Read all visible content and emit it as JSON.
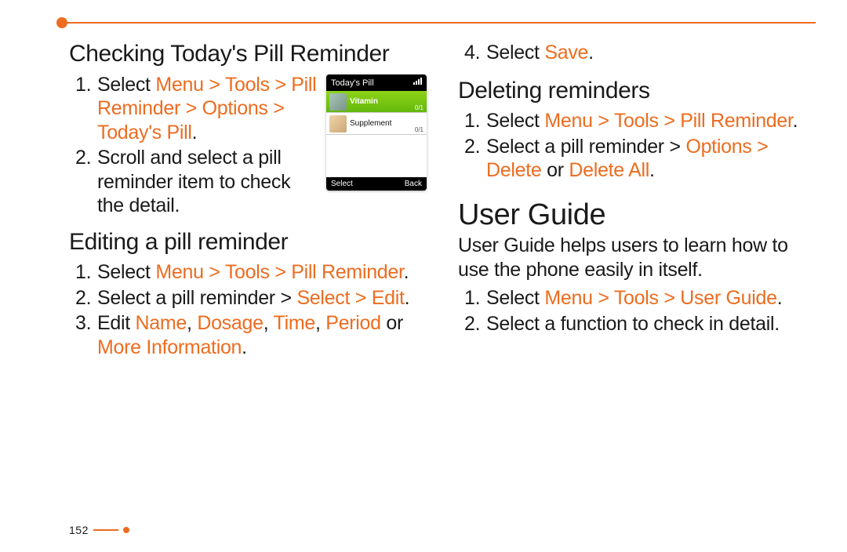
{
  "page_number": "152",
  "left": {
    "section1": {
      "title": "Checking Today's Pill Reminder",
      "step1_pre": "Select ",
      "step1_path": "Menu > Tools > Pill Reminder > Options > Today's Pill",
      "step1_post": ".",
      "step2": "Scroll and select a pill reminder item to check the detail."
    },
    "section2": {
      "title": "Editing a pill reminder",
      "step1_pre": "Select ",
      "step1_path": "Menu > Tools > Pill Reminder",
      "step1_post": ".",
      "step2_pre": "Select a pill reminder > ",
      "step2_path": "Select > Edit",
      "step2_post": ".",
      "step3_pre": "Edit ",
      "step3_p1": "Name",
      "step3_c1": ", ",
      "step3_p2": "Dosage",
      "step3_c2": ", ",
      "step3_p3": "Time",
      "step3_c3": ", ",
      "step3_p4": "Period",
      "step3_or": " or ",
      "step3_p5": "More Information",
      "step3_post": "."
    },
    "phone": {
      "title": "Today's Pill",
      "item1": "Vitamin",
      "item1_count": "0/1",
      "item2": "Supplement",
      "item2_count": "0/1",
      "softkey_left": "Select",
      "softkey_right": "Back"
    }
  },
  "right": {
    "step4_pre": "Select ",
    "step4_path": "Save",
    "step4_post": ".",
    "section3": {
      "title": "Deleting reminders",
      "step1_pre": "Select ",
      "step1_path": "Menu > Tools > Pill Reminder",
      "step1_post": ".",
      "step2_pre": "Select a pill reminder > ",
      "step2_p1": "Options > Delete",
      "step2_or": " or ",
      "step2_p2": "Delete All",
      "step2_post": "."
    },
    "section4": {
      "title": "User Guide",
      "intro": "User Guide helps users to learn how to use the phone easily in itself.",
      "step1_pre": "Select ",
      "step1_path": "Menu > Tools > User Guide",
      "step1_post": ".",
      "step2": "Select a function to check in detail."
    }
  }
}
